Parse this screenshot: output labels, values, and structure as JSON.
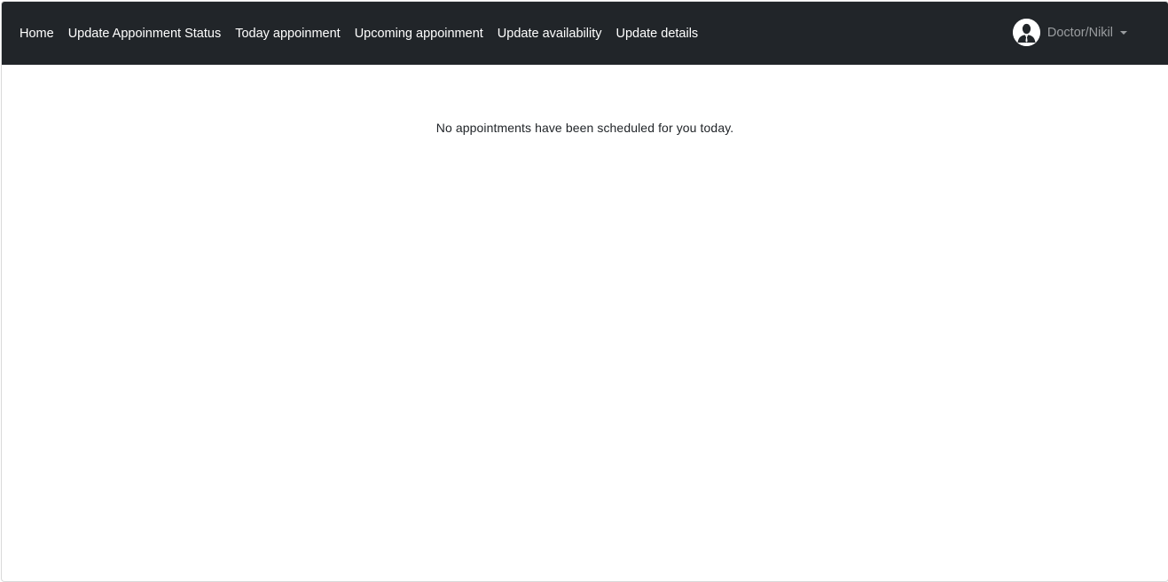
{
  "navbar": {
    "links": [
      {
        "label": "Home"
      },
      {
        "label": "Update Appoinment Status"
      },
      {
        "label": "Today appoinment"
      },
      {
        "label": "Upcoming appoinment"
      },
      {
        "label": "Update availability"
      },
      {
        "label": "Update details"
      }
    ],
    "user": {
      "name": "Doctor/Nikil",
      "avatar_icon": "user-avatar-icon",
      "dropdown_icon": "caret-down-icon"
    },
    "colors": {
      "background": "#212529",
      "link": "#ffffff",
      "user_text": "#9a9da0"
    }
  },
  "main": {
    "message": "No appointments have been scheduled for you today."
  }
}
